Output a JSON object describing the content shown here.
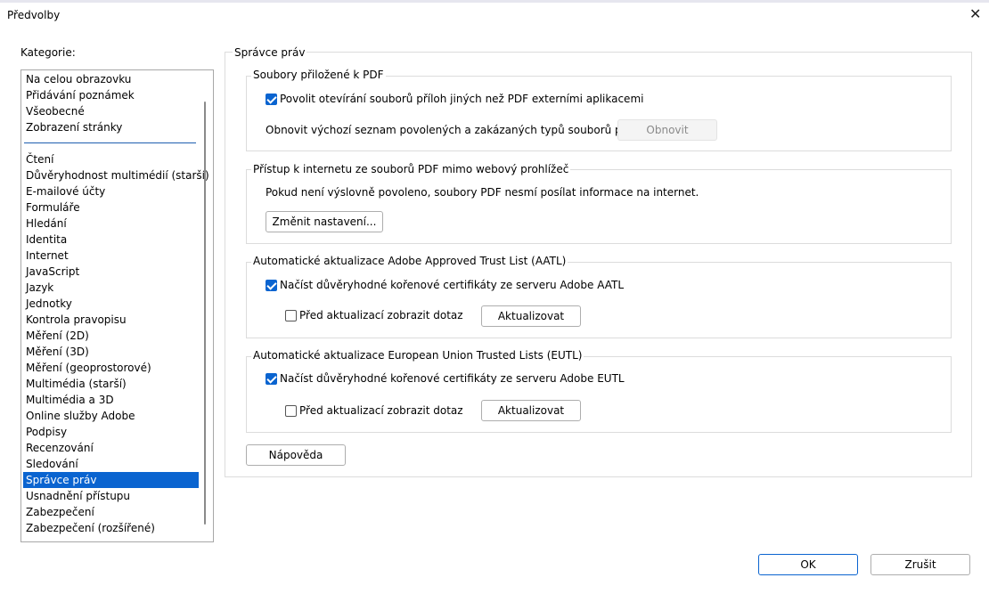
{
  "window": {
    "title": "Předvolby"
  },
  "categories": {
    "label": "Kategorie:",
    "pinned": [
      "Na celou obrazovku",
      "Přidávání poznámek",
      "Všeobecné",
      "Zobrazení stránky"
    ],
    "items": [
      "Čtení",
      "Důvěryhodnost multimédií (starší)",
      "E-mailové účty",
      "Formuláře",
      "Hledání",
      "Identita",
      "Internet",
      "JavaScript",
      "Jazyk",
      "Jednotky",
      "Kontrola pravopisu",
      "Měření (2D)",
      "Měření (3D)",
      "Měření (geoprostorové)",
      "Multimédia (starší)",
      "Multimédia a 3D",
      "Online služby Adobe",
      "Podpisy",
      "Recenzování",
      "Sledování",
      "Správce práv",
      "Usnadnění přístupu",
      "Zabezpečení",
      "Zabezpečení (rozšířené)"
    ],
    "selected": "Správce práv"
  },
  "panel": {
    "title": "Správce práv",
    "attachments": {
      "title": "Soubory přiložené k PDF",
      "allow_label": "Povolit otevírání souborů příloh jiných než PDF externími aplikacemi",
      "allow_checked": true,
      "restore_text": "Obnovit výchozí seznam povolených a zakázaných typů souborů příloh:",
      "restore_button": "Obnovit"
    },
    "internet": {
      "title": "Přístup k internetu ze souborů PDF mimo webový prohlížeč",
      "info": "Pokud není výslovně povoleno, soubory PDF nesmí posílat informace na internet.",
      "change_button": "Změnit nastavení..."
    },
    "aatl": {
      "title": "Automatické aktualizace Adobe Approved Trust List (AATL)",
      "load_label": "Načíst důvěryhodné kořenové certifikáty ze serveru Adobe AATL",
      "load_checked": true,
      "ask_label": "Před aktualizací zobrazit dotaz",
      "ask_checked": false,
      "update_button": "Aktualizovat"
    },
    "eutl": {
      "title": "Automatické aktualizace European Union Trusted Lists (EUTL)",
      "load_label": "Načíst důvěryhodné kořenové certifikáty ze serveru Adobe EUTL",
      "load_checked": true,
      "ask_label": "Před aktualizací zobrazit dotaz",
      "ask_checked": false,
      "update_button": "Aktualizovat"
    },
    "help_button": "Nápověda"
  },
  "footer": {
    "ok_button": "OK",
    "cancel_button": "Zrušit"
  },
  "colors": {
    "accent": "#0a64d0"
  }
}
